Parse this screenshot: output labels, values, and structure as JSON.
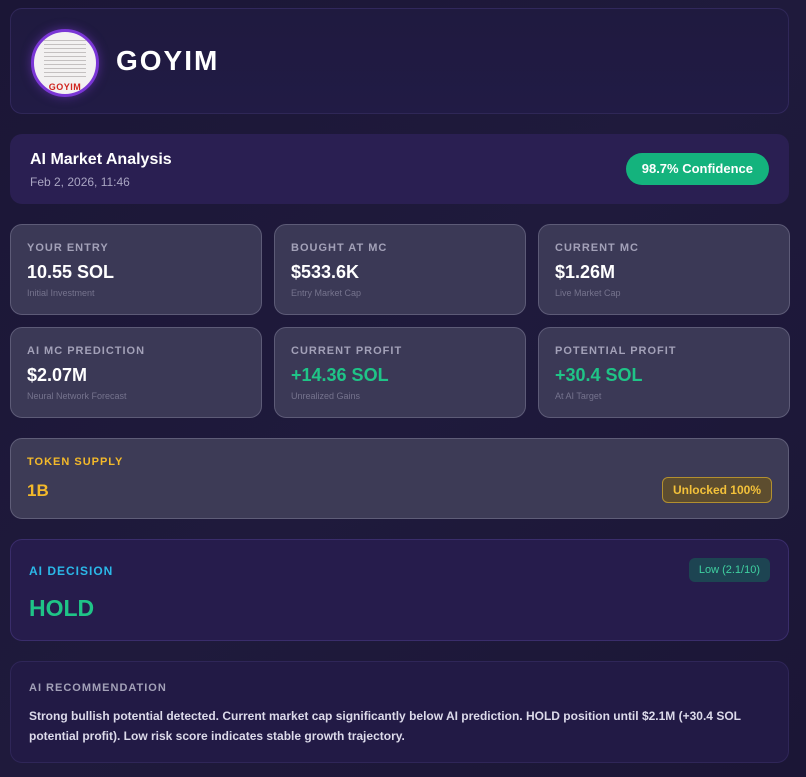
{
  "header": {
    "title": "GOYIM",
    "logo_text": "GOYIM"
  },
  "analysis": {
    "title": "AI Market Analysis",
    "date": "Feb 2, 2026, 11:46",
    "confidence": "98.7% Confidence"
  },
  "stats": [
    {
      "label": "YOUR ENTRY",
      "value": "10.55 SOL",
      "sub": "Initial Investment"
    },
    {
      "label": "BOUGHT AT MC",
      "value": "$533.6K",
      "sub": "Entry Market Cap"
    },
    {
      "label": "CURRENT MC",
      "value": "$1.26M",
      "sub": "Live Market Cap"
    },
    {
      "label": "AI MC PREDICTION",
      "value": "$2.07M",
      "sub": "Neural Network Forecast"
    },
    {
      "label": "CURRENT PROFIT",
      "value": "+14.36 SOL",
      "sub": "Unrealized Gains"
    },
    {
      "label": "POTENTIAL PROFIT",
      "value": "+30.4 SOL",
      "sub": "At AI Target"
    }
  ],
  "supply": {
    "label": "TOKEN SUPPLY",
    "value": "1B",
    "badge": "Unlocked 100%"
  },
  "decision": {
    "label": "AI DECISION",
    "value": "HOLD",
    "risk": "Low (2.1/10)"
  },
  "recommendation": {
    "label": "AI RECOMMENDATION",
    "text": "Strong bullish potential detected. Current market cap significantly below AI prediction. HOLD position until $2.1M (+30.4 SOL potential profit). Low risk score indicates stable growth trajectory."
  },
  "colors": {
    "background": "#1b1636",
    "accent_green": "#1fc487",
    "accent_yellow": "#f3b92a",
    "accent_cyan": "#2bb8e8",
    "confidence_badge": "#14b37d"
  }
}
